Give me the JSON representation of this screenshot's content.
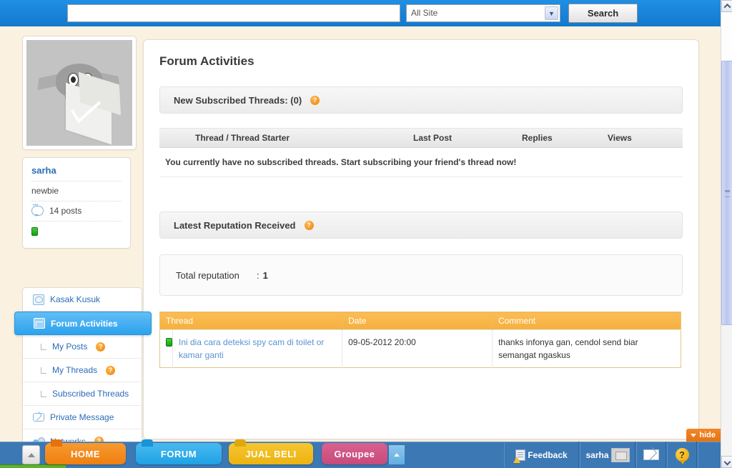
{
  "search": {
    "input_value": "",
    "input_placeholder": "",
    "site_filter_selected": "All Site",
    "site_filter_options": [
      "All Site"
    ],
    "search_button_label": "Search"
  },
  "sidebar": {
    "avatar_alt": "bird-with-envelope-avatar",
    "profile": {
      "username": "sarha",
      "rank": "newbie",
      "posts": "14 posts",
      "status": "online"
    },
    "menu": [
      {
        "label": "Kasak Kusuk",
        "icon": "kasak-kusuk-icon",
        "active": false,
        "sub": false,
        "help": false
      },
      {
        "label": "Forum Activities",
        "icon": "forum-icon",
        "active": true,
        "sub": false,
        "help": false
      },
      {
        "label": "My Posts",
        "icon": "tree-branch-icon",
        "active": false,
        "sub": true,
        "help": true
      },
      {
        "label": "My Threads",
        "icon": "tree-branch-icon",
        "active": false,
        "sub": true,
        "help": true
      },
      {
        "label": "Subscribed Threads",
        "icon": "tree-branch-icon",
        "active": false,
        "sub": true,
        "help": false
      },
      {
        "label": "Private Message",
        "icon": "mail-icon",
        "active": false,
        "sub": false,
        "help": false
      },
      {
        "label": "Networks",
        "icon": "networks-icon",
        "active": false,
        "sub": false,
        "help": true
      }
    ],
    "help_badge_glyph": "?"
  },
  "main": {
    "page_title": "Forum Activities",
    "subscribed": {
      "header_label": "New Subscribed Threads: (0)",
      "help_glyph": "?",
      "columns": [
        "Thread / Thread Starter",
        "Last Post",
        "Replies",
        "Views"
      ],
      "empty_message": "You currently have no subscribed threads. Start subscribing your friend's thread now!"
    },
    "reputation": {
      "header_label": "Latest Reputation Received",
      "help_glyph": "?",
      "total_label": "Total reputation",
      "total_colon": ":",
      "total_value": "1",
      "columns": [
        "Thread",
        "Date",
        "Comment"
      ],
      "rows": [
        {
          "status": "green",
          "thread": "Ini dia cara deteksi spy cam di toilet or kamar ganti",
          "date": "09-05-2012 20:00",
          "comment": "thanks infonya gan, cendol send biar semangat ngaskus"
        }
      ]
    }
  },
  "taskbar": {
    "start_label": "",
    "tabs": [
      {
        "label": "HOME",
        "color": "#ef7f10"
      },
      {
        "label": "FORUM",
        "color": "#1ea2e4"
      },
      {
        "label": "JUAL BELI",
        "color": "#edb211"
      },
      {
        "label": "Groupee",
        "color": "#c64b7c"
      }
    ],
    "feedback_label": "Feedback",
    "user_label": "sarha",
    "mail_label": "",
    "help_label": "?",
    "hide_label": "hide"
  },
  "colors": {
    "topbar_blue": "#1b87dc",
    "page_background": "#faf1e0",
    "active_menu_blue": "#2ba3ef",
    "link_blue": "#2b6cb8",
    "table_header_orange": "#f5b03e",
    "taskbar_blue": "#3c78b4",
    "status_green": "#13a013"
  }
}
